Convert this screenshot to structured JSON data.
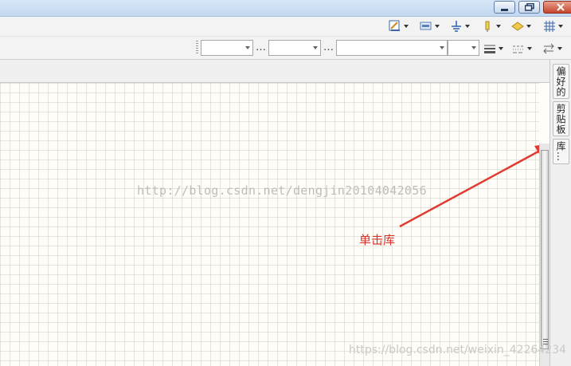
{
  "window": {
    "buttons": [
      {
        "name": "minimize",
        "icon": "minimize-icon"
      },
      {
        "name": "restore",
        "icon": "restore-icon"
      },
      {
        "name": "close",
        "icon": "close-icon"
      }
    ]
  },
  "toolbar_row1": {
    "items": [
      {
        "icon": "pen-edit-icon"
      },
      {
        "icon": "rectangle-style-icon"
      },
      {
        "icon": "ground-symbol-icon"
      },
      {
        "icon": "pin-icon"
      },
      {
        "icon": "fill-shape-icon"
      },
      {
        "icon": "grid-icon"
      }
    ]
  },
  "toolbar_row2": {
    "font_combo": {
      "value": ""
    },
    "size_combo": {
      "value": ""
    },
    "ellipsis_1": "…",
    "style_combo": {
      "value": ""
    },
    "ellipsis_2": "…",
    "line_combo": {
      "value": ""
    }
  },
  "side_tabs": [
    {
      "label": "偏好的"
    },
    {
      "label": "剪贴板"
    },
    {
      "label": "库…"
    }
  ],
  "canvas": {
    "watermark": "http://blog.csdn.net/dengjin20104042056",
    "annotation": "单击库",
    "footer_watermark": "https://blog.csdn.net/weixin_42264234"
  },
  "colors": {
    "annotation": "#d6302b",
    "grid_background": "#fffdf7"
  }
}
